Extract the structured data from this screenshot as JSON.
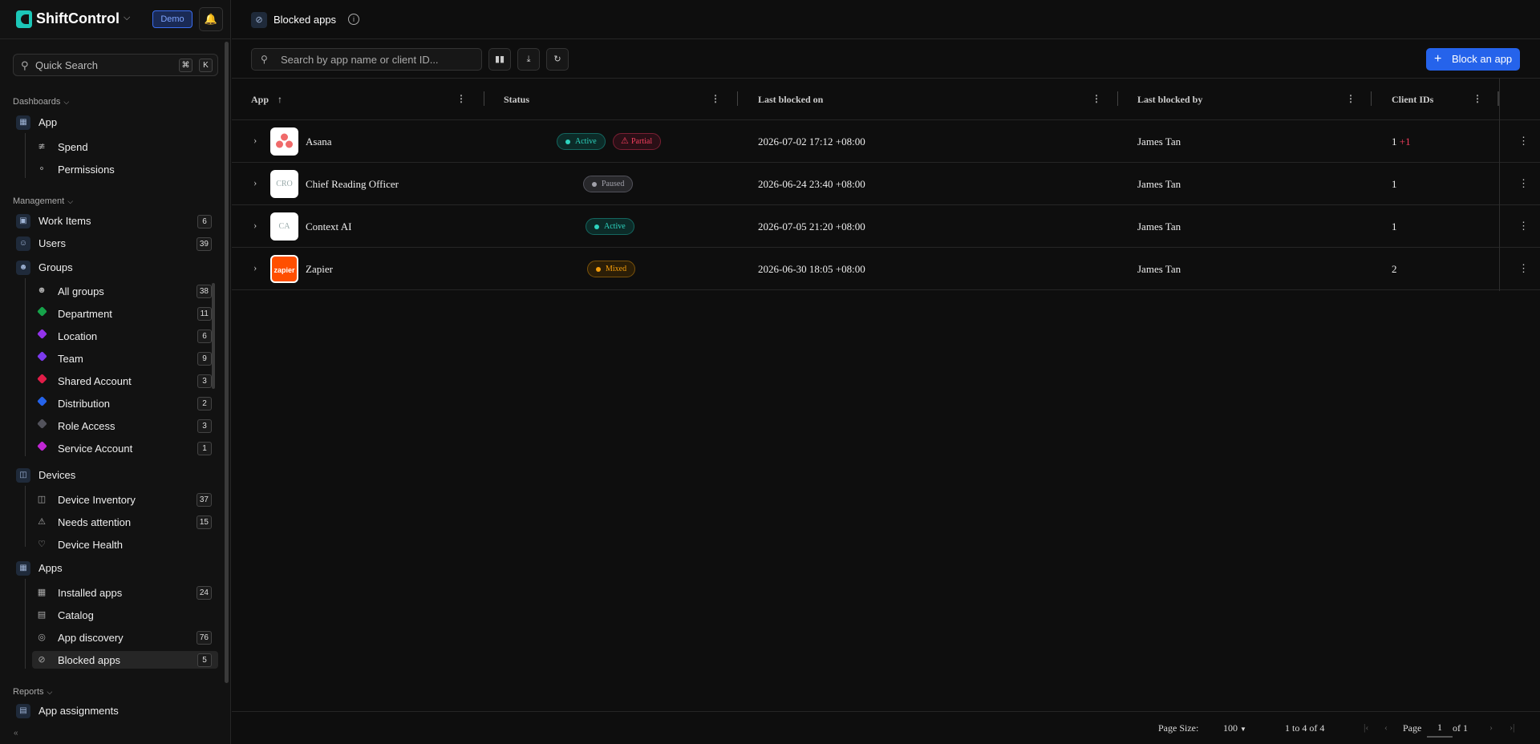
{
  "brand": {
    "name": "ShiftControl",
    "env_badge": "Demo"
  },
  "quick_search": {
    "placeholder": "Quick Search",
    "key1": "⌘",
    "key2": "K"
  },
  "sidebar": {
    "dashboards_label": "Dashboards",
    "app": "App",
    "spend": "Spend",
    "permissions": "Permissions",
    "management_label": "Management",
    "work_items": {
      "label": "Work Items",
      "count": "6"
    },
    "users": {
      "label": "Users",
      "count": "39"
    },
    "groups": "Groups",
    "group_items": [
      {
        "label": "All groups",
        "count": "38",
        "color": ""
      },
      {
        "label": "Department",
        "count": "11",
        "color": "#16a34a"
      },
      {
        "label": "Location",
        "count": "6",
        "color": "#9333ea"
      },
      {
        "label": "Team",
        "count": "9",
        "color": "#7c3aed"
      },
      {
        "label": "Shared Account",
        "count": "3",
        "color": "#e11d48"
      },
      {
        "label": "Distribution",
        "count": "2",
        "color": "#2563eb"
      },
      {
        "label": "Role Access",
        "count": "3",
        "color": "#52525b"
      },
      {
        "label": "Service Account",
        "count": "1",
        "color": "#c026d3"
      }
    ],
    "devices": "Devices",
    "device_items": [
      {
        "label": "Device Inventory",
        "count": "37"
      },
      {
        "label": "Needs attention",
        "count": "15"
      },
      {
        "label": "Device Health",
        "count": ""
      }
    ],
    "apps": "Apps",
    "app_items": [
      {
        "label": "Installed apps",
        "count": "24"
      },
      {
        "label": "Catalog",
        "count": ""
      },
      {
        "label": "App discovery",
        "count": "76"
      },
      {
        "label": "Blocked apps",
        "count": "5"
      }
    ],
    "reports_label": "Reports",
    "app_assignments": "App assignments",
    "collapse_glyph": "«"
  },
  "header": {
    "title": "Blocked apps"
  },
  "toolbar": {
    "search_placeholder": "Search by app name or client ID...",
    "block_button": "Block an app"
  },
  "table": {
    "columns": {
      "app": "App",
      "status": "Status",
      "last_blocked_on": "Last blocked on",
      "last_blocked_by": "Last blocked by",
      "client_ids": "Client IDs"
    },
    "rows": [
      {
        "icon_text": "",
        "name": "Asana",
        "status": "Active",
        "status2": "Partial",
        "last_blocked_on": "2026-07-02 17:12 +08:00",
        "last_blocked_by": "James Tan",
        "client_ids": "1",
        "client_extra": "+1"
      },
      {
        "icon_text": "CRO",
        "name": "Chief Reading Officer",
        "status": "Paused",
        "last_blocked_on": "2026-06-24 23:40 +08:00",
        "last_blocked_by": "James Tan",
        "client_ids": "1"
      },
      {
        "icon_text": "CA",
        "name": "Context AI",
        "status": "Active",
        "last_blocked_on": "2026-07-05 21:20 +08:00",
        "last_blocked_by": "James Tan",
        "client_ids": "1"
      },
      {
        "icon_text": "zapier",
        "name": "Zapier",
        "status": "Mixed",
        "last_blocked_on": "2026-06-30 18:05 +08:00",
        "last_blocked_by": "James Tan",
        "client_ids": "2"
      }
    ]
  },
  "footer": {
    "page_size_label": "Page Size:",
    "page_size": "100",
    "range": "1 to 4 of 4",
    "page_label": "Page",
    "page": "1",
    "of_total": "of 1"
  },
  "colors": {
    "accent": "#2563eb",
    "active": "#2dd4bf",
    "partial": "#f43f5e",
    "paused": "#a1a1aa",
    "mixed": "#f59e0b"
  }
}
